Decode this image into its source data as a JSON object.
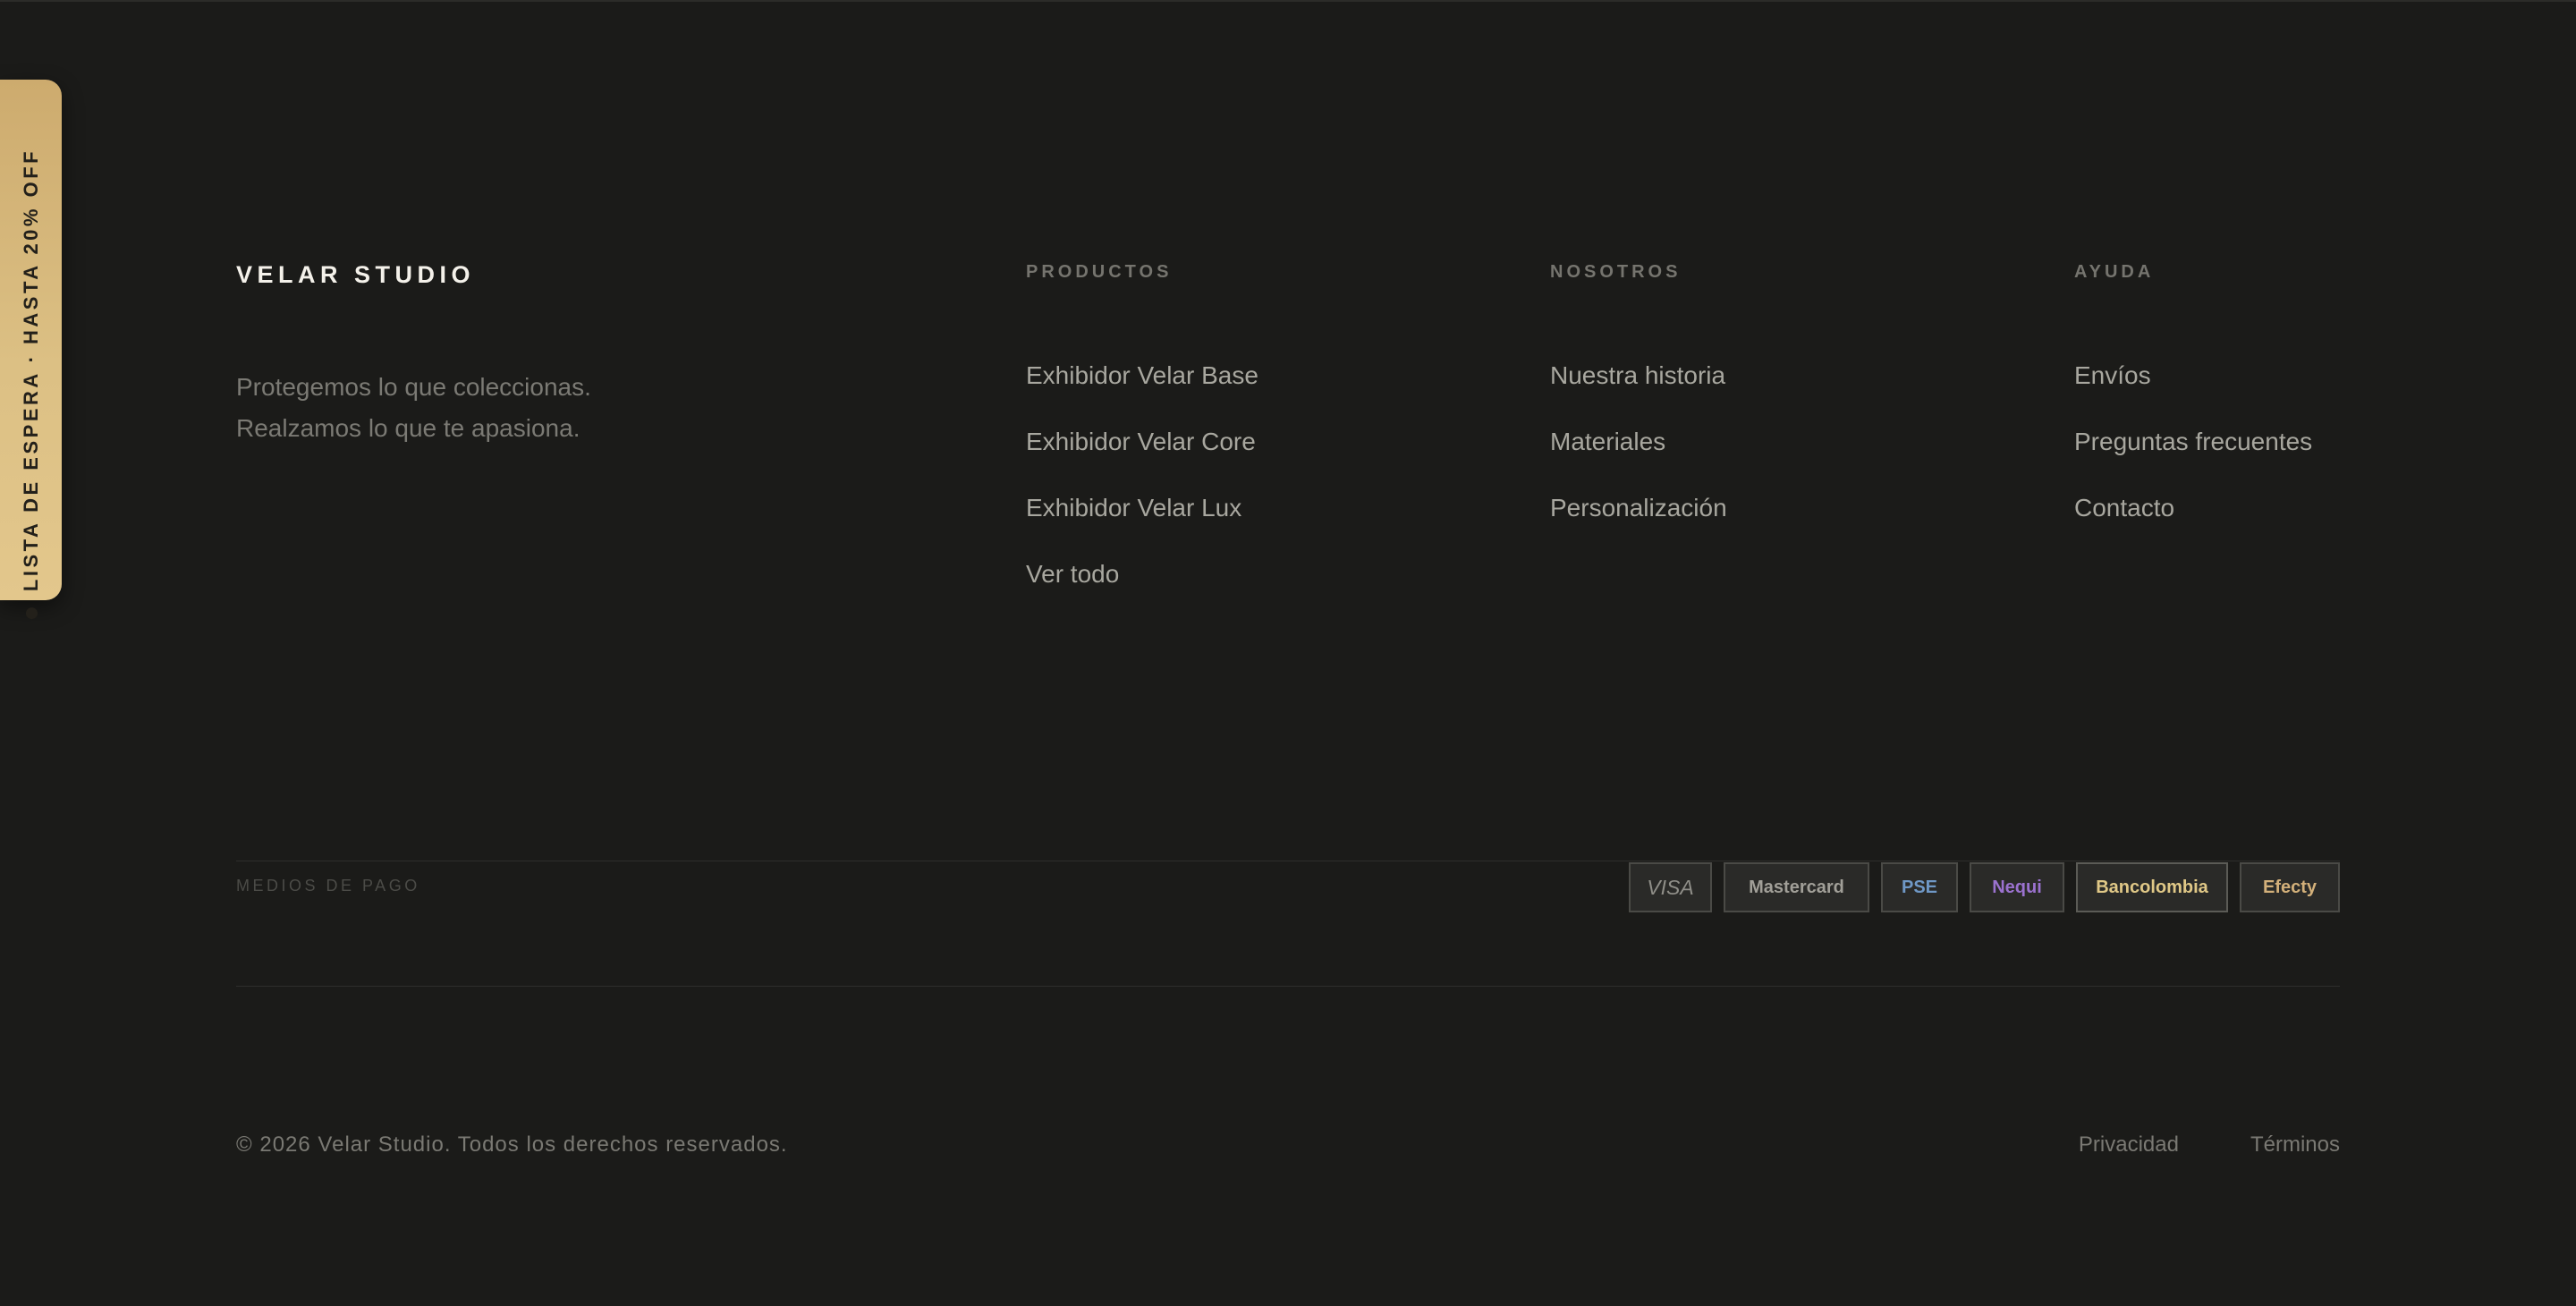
{
  "waitlist_tab": {
    "label": "LISTA DE ESPERA · HASTA 20% OFF"
  },
  "brand": {
    "name": "VELAR STUDIO",
    "tagline_line1": "Protegemos lo que coleccionas.",
    "tagline_line2": "Realzamos lo que te apasiona."
  },
  "columns": {
    "products": {
      "heading": "PRODUCTOS",
      "links": [
        "Exhibidor Velar Base",
        "Exhibidor Velar Core",
        "Exhibidor Velar Lux",
        "Ver todo"
      ]
    },
    "about": {
      "heading": "NOSOTROS",
      "links": [
        "Nuestra historia",
        "Materiales",
        "Personalización"
      ]
    },
    "help": {
      "heading": "AYUDA",
      "links": [
        "Envíos",
        "Preguntas frecuentes",
        "Contacto"
      ]
    }
  },
  "payments": {
    "label": "MEDIOS DE PAGO",
    "methods": [
      {
        "name": "VISA",
        "color": "#8f8e88"
      },
      {
        "name": "Mastercard",
        "color": "#a19f98"
      },
      {
        "name": "PSE",
        "color": "#6f98c6"
      },
      {
        "name": "Nequi",
        "color": "#9b72cf"
      },
      {
        "name": "Bancolombia",
        "color": "#e0c887"
      },
      {
        "name": "Efecty",
        "color": "#d3b07a"
      }
    ]
  },
  "bottom": {
    "copyright": "© 2026 Velar Studio. Todos los derechos reservados.",
    "privacy": "Privacidad",
    "terms": "Términos"
  },
  "colors": {
    "background": "#1b1b19",
    "accent_gold": "#dcc084"
  }
}
